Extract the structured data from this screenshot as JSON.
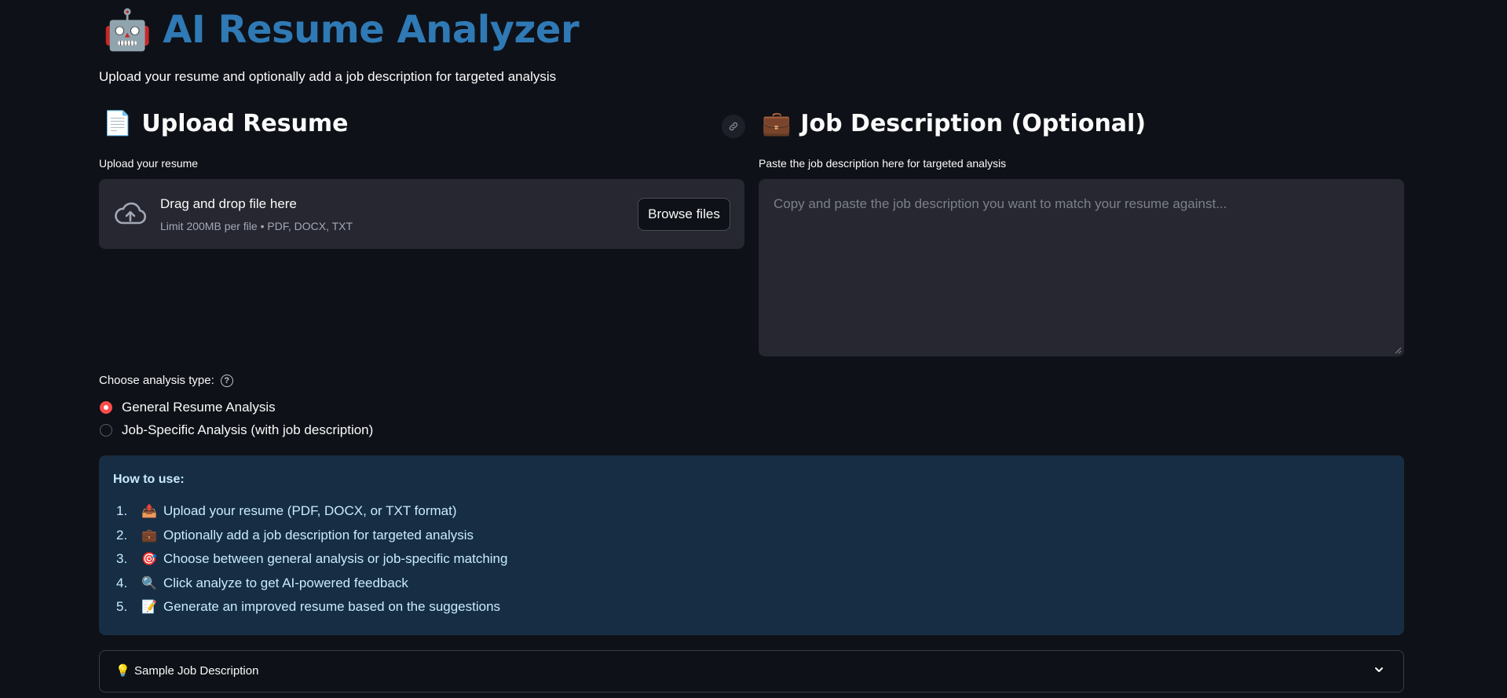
{
  "header": {
    "emoji": "🤖",
    "title": "AI Resume Analyzer",
    "subtitle": "Upload your resume and optionally add a job description for targeted analysis"
  },
  "upload": {
    "emoji": "📄",
    "title": "Upload Resume",
    "label": "Upload your resume",
    "dropzone_title": "Drag and drop file here",
    "dropzone_limit": "Limit 200MB per file • PDF, DOCX, TXT",
    "browse_label": "Browse files"
  },
  "job": {
    "emoji": "💼",
    "title": "Job Description (Optional)",
    "label": "Paste the job description here for targeted analysis",
    "placeholder": "Copy and paste the job description you want to match your resume against..."
  },
  "analysis": {
    "label": "Choose analysis type:",
    "options": [
      {
        "label": "General Resume Analysis",
        "selected": true
      },
      {
        "label": "Job-Specific Analysis (with job description)",
        "selected": false
      }
    ]
  },
  "how_to": {
    "title": "How to use:",
    "steps": [
      {
        "num": "1.",
        "icon": "📤",
        "text": "Upload your resume (PDF, DOCX, or TXT format)"
      },
      {
        "num": "2.",
        "icon": "💼",
        "text": "Optionally add a job description for targeted analysis"
      },
      {
        "num": "3.",
        "icon": "🎯",
        "text": "Choose between general analysis or job-specific matching"
      },
      {
        "num": "4.",
        "icon": "🔍",
        "text": "Click analyze to get AI-powered feedback"
      },
      {
        "num": "5.",
        "icon": "📝",
        "text": "Generate an improved resume based on the suggestions"
      }
    ]
  },
  "expander": {
    "icon": "💡",
    "label": "Sample Job Description"
  },
  "colors": {
    "background": "#0e1117",
    "title": "#2f79b5",
    "accent": "#ff4b4b",
    "info_bg": "#172d43",
    "info_text": "#c7ebff"
  }
}
